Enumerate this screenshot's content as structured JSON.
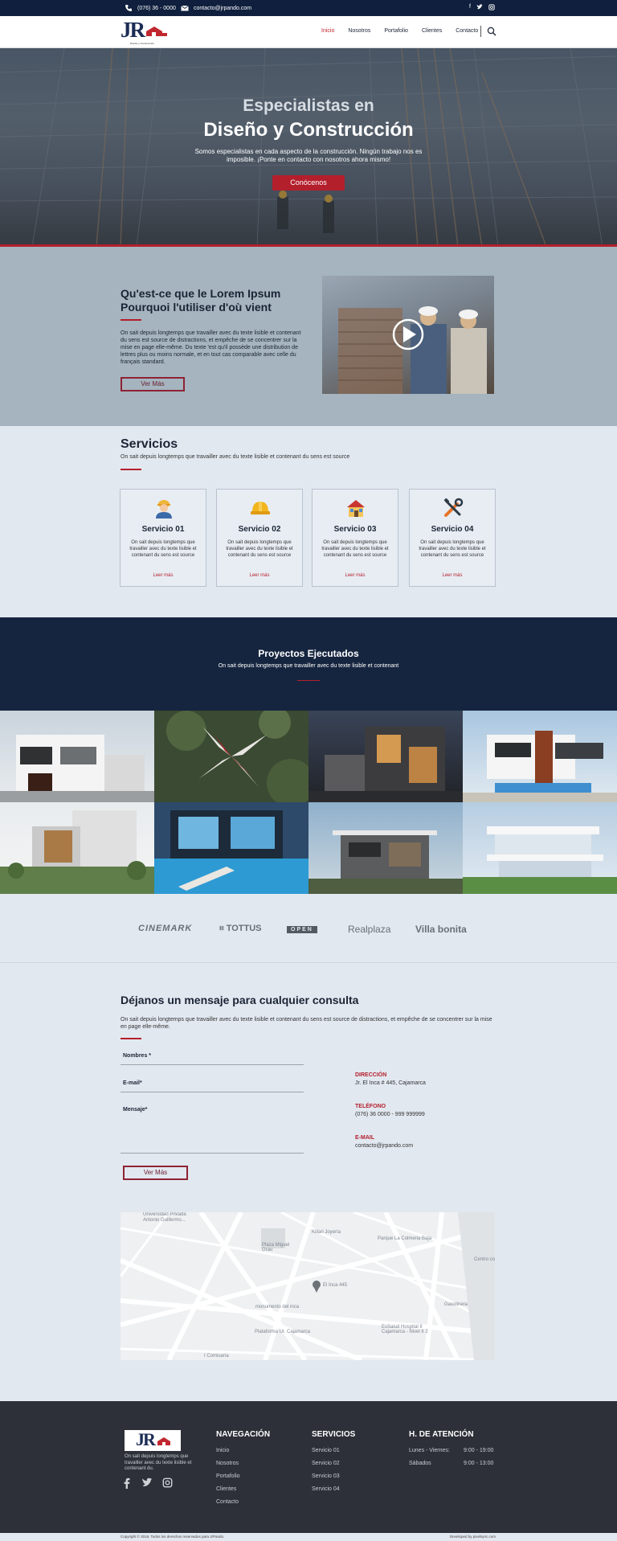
{
  "topbar": {
    "phone": "(076) 36 - 0000",
    "email": "contacto@jrpando.com",
    "social_icons": [
      "facebook-icon",
      "twitter-icon",
      "instagram-icon"
    ]
  },
  "header": {
    "logo_text": "JR",
    "logo_sub": "Diseño y Construcción",
    "nav": [
      "Inicio",
      "Nosotros",
      "Portafolio",
      "Clientes",
      "Contacto"
    ],
    "active_nav": "Inicio"
  },
  "hero": {
    "kicker": "Especialistas en",
    "title": "Diseño y Construcción",
    "text": "Somos especialistas en cada aspecto de la construcción. Ningún trabajo nos es imposible. ¡Ponte en contacto con nosotros ahora mismo!",
    "button": "Conócenos"
  },
  "about": {
    "title": "Qu'est-ce que le Lorem Ipsum Pourquoi l'utiliser d'où vient",
    "text": "On sait depuis longtemps que travailler avec du texte lisible et contenant du sens est source de distractions, et empêche de se concentrer sur la mise en page elle-même. Du texte 'est qu'il possède une distribution de lettres plus ou moins normale, et en tout cas comparable avec celle du français standard.",
    "button": "Ver Más"
  },
  "services": {
    "title": "Servicios",
    "subtitle": "On sait depuis longtemps que travailler avec du texte lisible et contenant du sens est source",
    "items": [
      {
        "title": "Servicio 01",
        "text": "On sait depuis longtemps que travailler avec du texte lisible et contenant du sens est source",
        "link": "Leer más",
        "icon": "worker-icon"
      },
      {
        "title": "Servicio 02",
        "text": "On sait depuis longtemps que travailler avec du texte lisible et contenant du sens est source",
        "link": "Leer más",
        "icon": "helmet-icon"
      },
      {
        "title": "Servicio 03",
        "text": "On sait depuis longtemps que travailler avec du texte lisible et contenant du sens est source",
        "link": "Leer más",
        "icon": "house-icon"
      },
      {
        "title": "Servicio 04",
        "text": "On sait depuis longtemps que travailler avec du texte lisible et contenant du sens est source",
        "link": "Leer más",
        "icon": "tools-icon"
      }
    ]
  },
  "projects": {
    "title": "Proyectos Ejecutados",
    "subtitle": "On sait depuis longtemps que travailler avec du texte lisible et contenant"
  },
  "brands": [
    "CINEMARK",
    "TOTTUS",
    "OPEN",
    "Realplaza",
    "Villa bonita"
  ],
  "contact": {
    "title": "Déjanos un mensaje para cualquier consulta",
    "intro": "On sait depuis longtemps que travailler avec du texte lisible et contenant du sens est source de distractions, et empêche de se concentrer sur la mise en page elle-même.",
    "fields": {
      "name": "Nombres *",
      "email": "E-mail*",
      "message": "Mensaje*"
    },
    "button": "Ver Más",
    "info": {
      "address_label": "DIRECCIÓN",
      "address": "Jr. El Inca # 445, Cajamarca",
      "phone_label": "TELÉFONO",
      "phone": "(076) 36 0000 - 999 999999",
      "email_label": "E-MAIL",
      "email": "contacto@jrpando.com"
    }
  },
  "map": {
    "labels": [
      "Universidad Privada Antonio Guillermo...",
      "Killari Joyería",
      "Parque La Colmena Baja",
      "Plaza Miguel Grau",
      "Centro co",
      "El Inca 445",
      "monumento del inca",
      "Gasolinera",
      "EsSalud Hospital II Cajamarca - Nivel II 2",
      "Plataforma Ur. Cajamarca",
      "I Comisaría"
    ]
  },
  "footer": {
    "logo_text": "JR",
    "description": "On sait depuis longtemps que travailler avec du texte lisible et contenant du.",
    "nav_title": "NAVEGACIÓN",
    "nav": [
      "Inicio",
      "Nosotros",
      "Portafolio",
      "Clientes",
      "Contacto"
    ],
    "services_title": "SERVICIOS",
    "services": [
      "Servicio 01",
      "Servicio 02",
      "Servicio 03",
      "Servicio 04"
    ],
    "hours_title": "H. DE ATENCIÓN",
    "hours": [
      {
        "day": "Lunes - Viernes:",
        "time": "9:00 - 19:00"
      },
      {
        "day": "Sábados",
        "time": "9:00 - 13:00"
      }
    ],
    "copyright": "Copyright © 2016. Todos los derechos reservados para JrPando.",
    "developer": "Developed by pixelsync.com"
  },
  "colors": {
    "accent": "#b41f2c",
    "navy": "#0f1f3d",
    "footer": "#2d3038"
  }
}
